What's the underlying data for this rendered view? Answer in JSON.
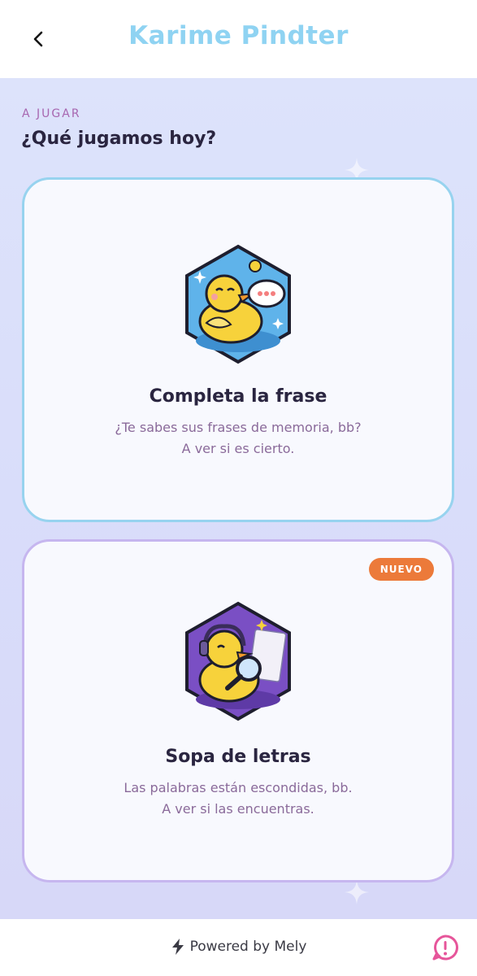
{
  "header": {
    "title": "Karime Pindter",
    "back_icon": "chevron-left-icon"
  },
  "section": {
    "eyebrow": "A JUGAR",
    "title": "¿Qué jugamos hoy?"
  },
  "games": [
    {
      "title": "Completa la frase",
      "desc_line1": "¿Te sabes sus frases de memoria, bb?",
      "desc_line2": "A ver si es cierto.",
      "icon": "duck-speech-bubble-icon",
      "border_color": "#97d3ef"
    },
    {
      "badge": "NUEVO",
      "title": "Sopa de letras",
      "desc_line1": "Las palabras están escondidas, bb.",
      "desc_line2": "A ver si las encuentras.",
      "icon": "duck-magnifier-icon",
      "border_color": "#c6b6ef"
    }
  ],
  "footer": {
    "powered_label": "Powered by Mely",
    "help_icon": "feedback-icon"
  },
  "colors": {
    "title": "#8fd3f2",
    "badge": "#ec7a3a",
    "accent": "#a766b0"
  }
}
